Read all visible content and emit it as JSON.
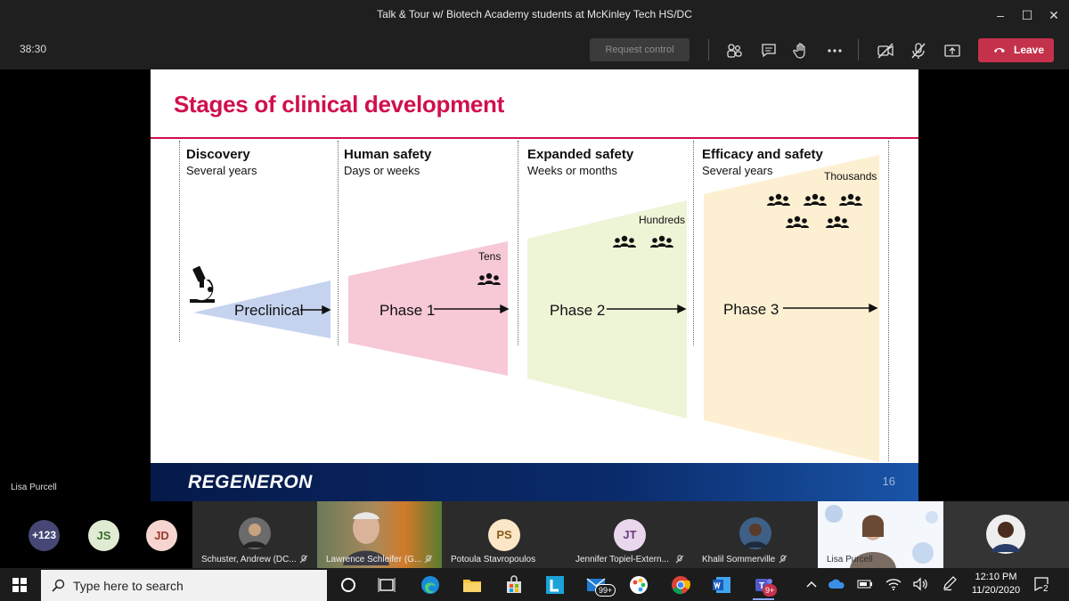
{
  "window": {
    "title": "Talk & Tour w/ Biotech Academy students at McKinley Tech HS/DC"
  },
  "toolbar": {
    "timer": "38:30",
    "request_control": "Request control",
    "leave": "Leave"
  },
  "slide": {
    "title": "Stages of clinical development",
    "columns": [
      {
        "heading": "Discovery",
        "sub": "Several years",
        "phase": "Preclinical",
        "count": ""
      },
      {
        "heading": "Human safety",
        "sub": "Days or weeks",
        "phase": "Phase 1",
        "count": "Tens"
      },
      {
        "heading": "Expanded safety",
        "sub": "Weeks or months",
        "phase": "Phase 2",
        "count": "Hundreds"
      },
      {
        "heading": "Efficacy and safety",
        "sub": "Several years",
        "phase": "Phase 3",
        "count": "Thousands"
      }
    ],
    "colors": {
      "preclinical": "#c5d3ef",
      "phase1": "#f7c8d6",
      "phase2": "#eef4d6",
      "phase3": "#fdf0d2",
      "accent": "#d0104c"
    },
    "footer_logo": "REGENERON",
    "page_number": "16"
  },
  "presenter_label": "Lisa Purcell",
  "participants": {
    "overflow": "+123",
    "avatars": [
      {
        "initials": "JS",
        "bg": "#dfecd3",
        "fg": "#3b6b2a"
      },
      {
        "initials": "JD",
        "bg": "#f6d5d0",
        "fg": "#9a3a2f"
      }
    ],
    "tiles": [
      {
        "name": "Schuster, Andrew (DC..."
      },
      {
        "name": "Lawrence Schleifer (G..."
      },
      {
        "name": "Potoula Stavropoulos",
        "initials": "PS",
        "bg": "#fbe6c7",
        "fg": "#8a5a17"
      },
      {
        "name": "Jennifer Topiel-Extern...",
        "initials": "JT",
        "bg": "#ead7ee",
        "fg": "#6b3f79"
      },
      {
        "name": "Khalil Sommerville"
      },
      {
        "name": "Lisa Purcell"
      },
      {
        "name": ""
      }
    ]
  },
  "taskbar": {
    "search_placeholder": "Type here to search",
    "mail_badge": "99+",
    "teams_badge": "9+",
    "time": "12:10 PM",
    "date": "11/20/2020",
    "notif_count": "2"
  }
}
